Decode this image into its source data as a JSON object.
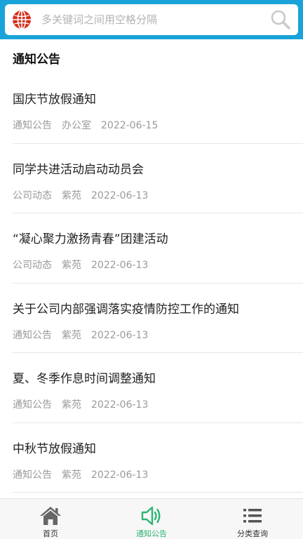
{
  "search": {
    "placeholder": "多关键词之间用空格分隔",
    "icon": "search-icon",
    "logo_icon": "globe-icon"
  },
  "section": {
    "title": "通知公告"
  },
  "articles": [
    {
      "title": "国庆节放假通知",
      "category": "通知公告",
      "author": "办公室",
      "date": "2022-06-15"
    },
    {
      "title": "同学共进活动启动动员会",
      "category": "公司动态",
      "author": "紫苑",
      "date": "2022-06-13"
    },
    {
      "title": "“凝心聚力激扬青春”团建活动",
      "category": "公司动态",
      "author": "紫苑",
      "date": "2022-06-13"
    },
    {
      "title": "关于公司内部强调落实疫情防控工作的通知",
      "category": "通知公告",
      "author": "紫苑",
      "date": "2022-06-13"
    },
    {
      "title": "夏、冬季作息时间调整通知",
      "category": "通知公告",
      "author": "紫苑",
      "date": "2022-06-13"
    },
    {
      "title": "中秋节放假通知",
      "category": "通知公告",
      "author": "紫苑",
      "date": "2022-06-13"
    }
  ],
  "tabbar": {
    "items": [
      {
        "label": "首页",
        "icon": "home-icon",
        "active": false
      },
      {
        "label": "通知公告",
        "icon": "speaker-icon",
        "active": true
      },
      {
        "label": "分类查询",
        "icon": "list-icon",
        "active": false
      }
    ]
  },
  "colors": {
    "header": "#19a3d9",
    "active_tab": "#2bb673",
    "meta_text": "#9a9a9a"
  }
}
